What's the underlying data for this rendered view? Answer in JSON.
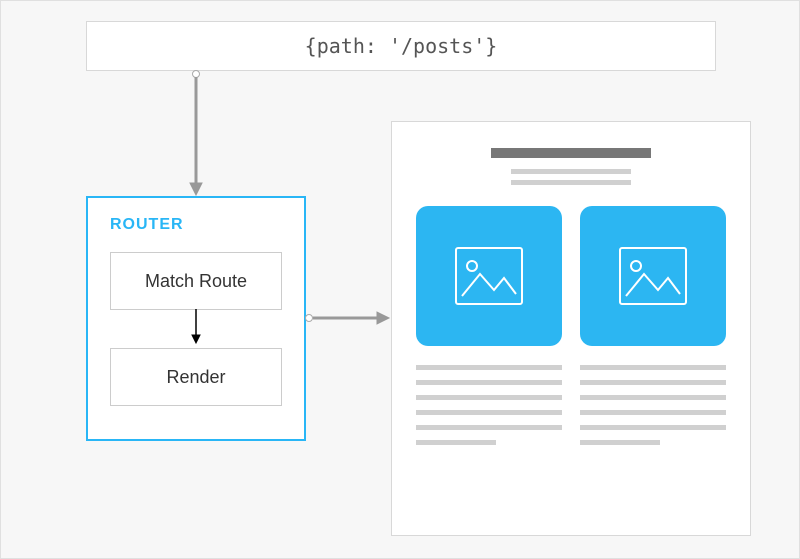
{
  "path_box": "{path: '/posts'}",
  "router": {
    "title": "ROUTER",
    "steps": [
      "Match Route",
      "Render"
    ]
  },
  "colors": {
    "accent": "#29b6f6",
    "card_bg": "#2cb6f2"
  }
}
